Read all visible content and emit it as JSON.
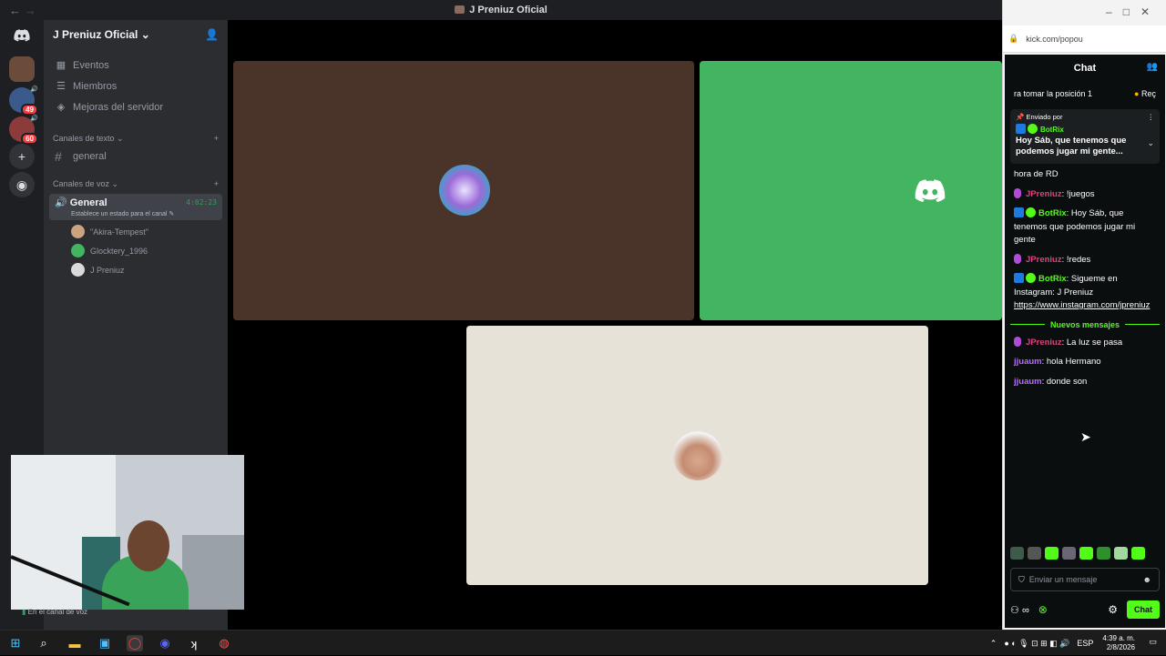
{
  "window": {
    "title": "J Preniuz Oficial",
    "back_glyph": "←",
    "forward_glyph": "→"
  },
  "server": {
    "name": "J Preniuz Oficial",
    "menu": [
      {
        "label": "Eventos",
        "icon": "calendar-icon"
      },
      {
        "label": "Miembros",
        "icon": "members-icon"
      },
      {
        "label": "Mejoras del servidor",
        "icon": "boost-icon"
      }
    ],
    "text_category": "Canales de texto",
    "text_channels": [
      "general"
    ],
    "voice_category": "Canales de voz",
    "voice_channel": {
      "name": "General",
      "timer": "4:02:23",
      "status_hint": "Establece un estado para el canal"
    },
    "voice_users": [
      "\"Akira-Tempest\"",
      "Glocktery_1996",
      "J Preniuz"
    ]
  },
  "rail": {
    "badges": [
      "49",
      "60"
    ]
  },
  "voice_status": "En el canal de voz",
  "kick": {
    "url": "kick.com/popou",
    "chat_title": "Chat",
    "ticker_text": "ra tomar la posición 1",
    "ticker_action": "Reç",
    "pinned": {
      "header": "Enviado por",
      "author": "BotRix",
      "text": "Hoy Sáb, que tenemos que podemos jugar mi gente..."
    },
    "partial_message": "hora de RD",
    "messages": [
      {
        "user": "JPreniuz",
        "text": ": !juegos",
        "type": "broadcaster"
      },
      {
        "user": "BotRix",
        "text": ": Hoy Sáb, que tenemos que podemos jugar mi gente",
        "type": "bot"
      },
      {
        "user": "JPreniuz",
        "text": ": !redes",
        "type": "broadcaster"
      },
      {
        "user": "BotRix",
        "text": ": Sigueme en Instagram: J Preniuz",
        "link": "https://www.instagram.com/jpreniuz",
        "type": "bot"
      }
    ],
    "new_messages_label": "Nuevos mensajes",
    "new_messages": [
      {
        "user": "JPreniuz",
        "text": ": La luz se pasa",
        "type": "broadcaster"
      },
      {
        "user": "jjuaum",
        "text": ": hola Hermano",
        "type": "viewer"
      },
      {
        "user": "jjuaum",
        "text": ": donde son",
        "type": "viewer"
      }
    ],
    "input_placeholder": "Enviar un mensaje",
    "chat_button": "Chat"
  },
  "taskbar": {
    "language": "ESP",
    "time": "4:39 a. m.",
    "date": "2/8/2026"
  },
  "colors": {
    "kick_green": "#53fc18",
    "discord_green": "#43b560",
    "tile_brown": "#4a3429",
    "tile_cream": "#e6e2d8"
  }
}
